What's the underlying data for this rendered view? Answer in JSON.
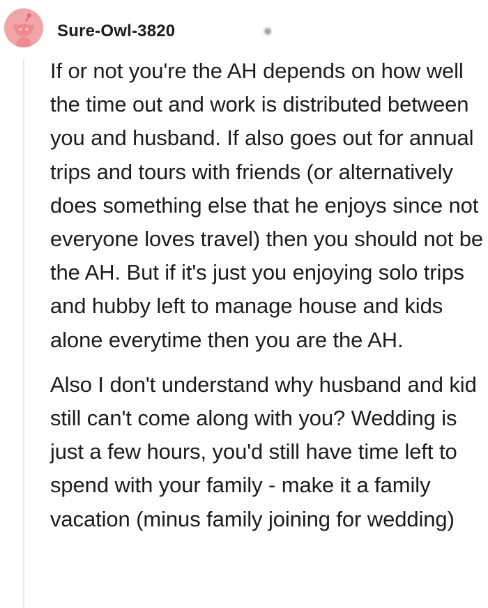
{
  "comment": {
    "author": "Sure-Owl-3820",
    "avatar_icon": "reddit-snoo-avatar-icon",
    "avatar_color": "#f2a5a8",
    "paragraphs": [
      "If or not you're the AH depends on how well the time out and work is distributed between you and husband. If also goes out for annual trips and tours with friends (or alternatively does something else that he enjoys since not everyone loves travel) then you should not be the AH. But if it's just you enjoying solo trips and hubby left to manage house and kids alone everytime then you are the AH.",
      "Also I don't understand why husband and kid still can't come along with you? Wedding is just a few hours, you'd still have time left to spend with your family - make it a family vacation (minus family joining for wedding)"
    ]
  }
}
